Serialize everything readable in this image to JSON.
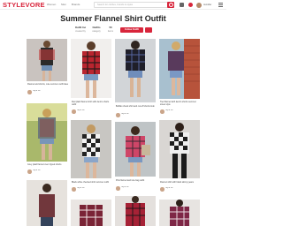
{
  "brand": {
    "logo": "STYLEVORE",
    "accent": "#d8253b"
  },
  "nav": {
    "items": [
      "Women",
      "Men",
      "Brands"
    ]
  },
  "search": {
    "placeholder": "Search for clothes, brands & styles"
  },
  "header": {
    "user_label": "Jennifer"
  },
  "page": {
    "title": "Summer Flannel Shirt Outfit"
  },
  "stats": [
    {
      "value": "Outfit Inc",
      "label": "created by"
    },
    {
      "value": "Outfits",
      "label": "category"
    },
    {
      "value": "50",
      "label": "items"
    }
  ],
  "actions": {
    "follow_label": "Follow Outfit"
  },
  "pins": [
    {
      "desc": "Flannel and shorts, cute summer outfit idea",
      "user": "Style Inc"
    },
    {
      "desc": "Red plaid flannel shirt with denim shorts outfit",
      "user": "Style Inc"
    },
    {
      "desc": "Buffalo check shirt and cut-off shorts look",
      "user": "Style Inc"
    },
    {
      "desc": "Tied flannel with denim shorts summer street style",
      "user": "Style Inc"
    },
    {
      "desc": "Grey plaid flannel over ripped shorts",
      "user": "Style Inc"
    },
    {
      "desc": "Black white checked shirt summer outfit",
      "user": "Style Inc"
    },
    {
      "desc": "Pink flannel and tote bag outfit",
      "user": "Style Inc"
    },
    {
      "desc": "Flannel shirt with black skinny jeans",
      "user": "Style Inc"
    },
    {
      "desc": "",
      "user": ""
    },
    {
      "desc": "",
      "user": ""
    },
    {
      "desc": "",
      "user": ""
    },
    {
      "desc": "",
      "user": ""
    }
  ]
}
